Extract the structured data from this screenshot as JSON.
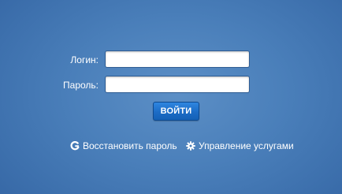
{
  "login_form": {
    "login_label": "Логин:",
    "login_value": "",
    "password_label": "Пароль:",
    "password_value": "",
    "submit_label": "ВОЙТИ"
  },
  "links": {
    "restore_password": {
      "label": "Восстановить пароль",
      "icon": "refresh-g-icon"
    },
    "manage_services": {
      "label": "Управление услугами",
      "icon": "gear-icon"
    }
  },
  "colors": {
    "background": "#4a7fba",
    "button": "#1c6cc6",
    "text": "#ffffff"
  }
}
